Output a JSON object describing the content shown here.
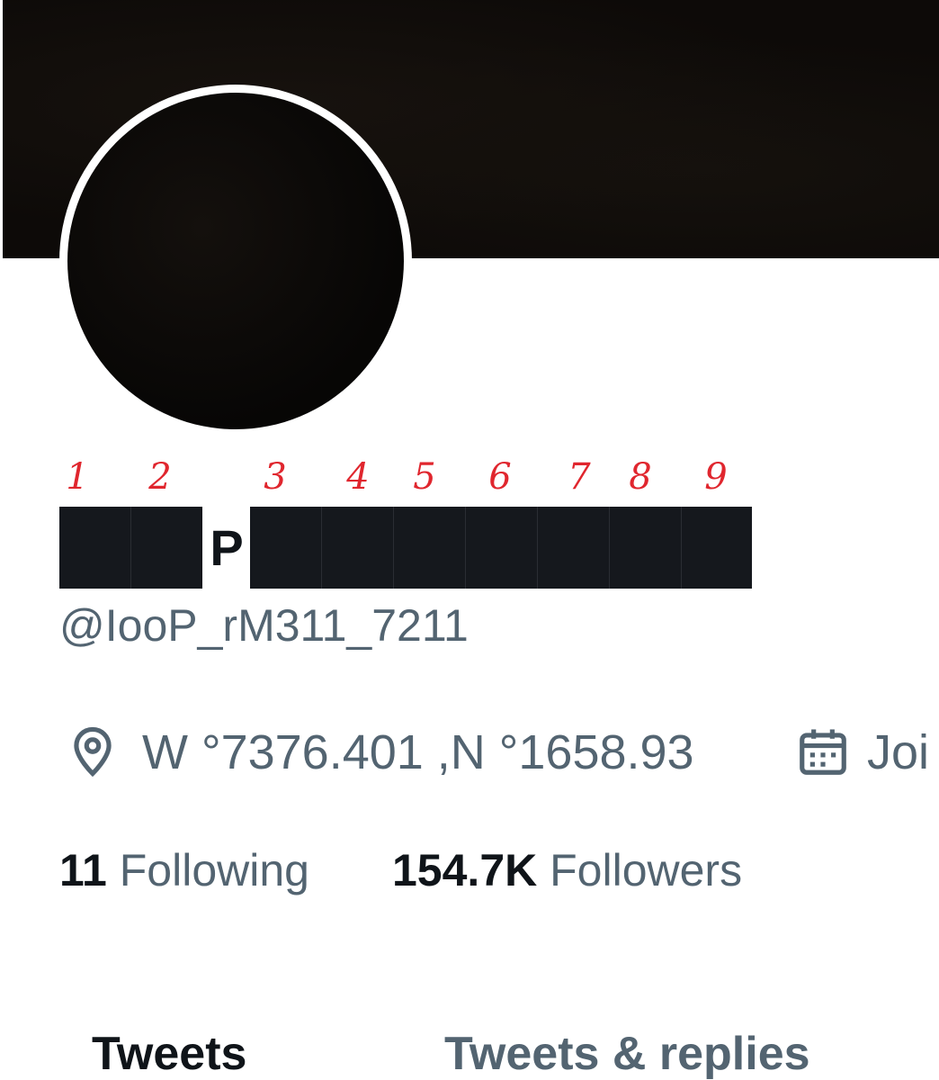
{
  "profile": {
    "name_annotations": [
      "1",
      "2",
      "3",
      "4",
      "5",
      "6",
      "7",
      "8",
      "9"
    ],
    "name_visible_letter": "P",
    "handle": "@IooP_rM311_7211",
    "location": "W °7376.401 ,N °1658.93",
    "joined": "Joi"
  },
  "stats": {
    "following_count": "11",
    "following_label": "Following",
    "followers_count": "154.7K",
    "followers_label": "Followers"
  },
  "tabs": [
    {
      "label": "Tweets",
      "active": true
    },
    {
      "label": "Tweets & replies",
      "active": false
    }
  ],
  "icons": {
    "location": "location-pin-icon",
    "joined": "calendar-icon"
  },
  "colors": {
    "annotation": "#e0262e",
    "secondary_text": "#536471",
    "primary_text": "#0f1419",
    "redaction": "#15181d"
  }
}
